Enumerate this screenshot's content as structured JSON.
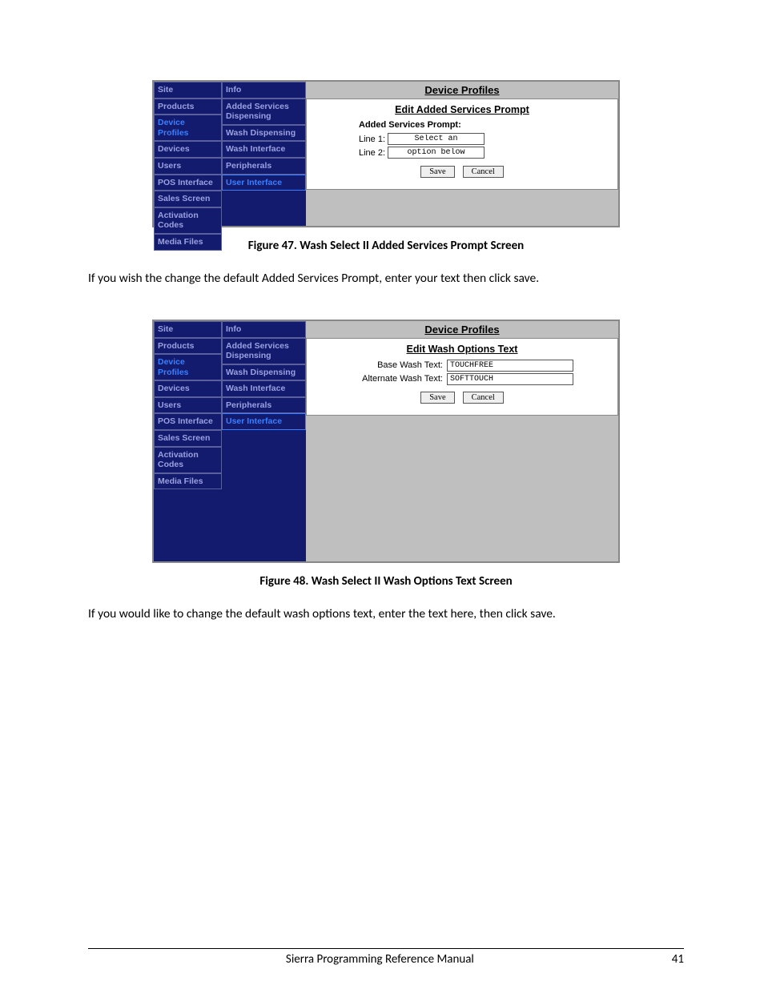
{
  "fig47": {
    "nav1": [
      "Site",
      "Products",
      "Device Profiles",
      "Devices",
      "Users",
      "POS Interface",
      "Sales Screen",
      "Activation Codes",
      "Media Files"
    ],
    "nav1_sel": "Device Profiles",
    "nav2": [
      "Info",
      "Added Services Dispensing",
      "Wash Dispensing",
      "Wash Interface",
      "Peripherals",
      "User Interface"
    ],
    "nav2_sel": "User Interface",
    "title": "Device Profiles",
    "subtitle": "Edit Added Services Prompt",
    "prompt_label": "Added Services Prompt:",
    "line1_lbl": "Line 1:",
    "line1_val": "Select an",
    "line2_lbl": "Line 2:",
    "line2_val": "option below",
    "save": "Save",
    "cancel": "Cancel",
    "caption": "Figure 47. Wash Select II Added Services Prompt Screen"
  },
  "para1": "If you wish the change the default Added Services Prompt, enter your text then click save.",
  "fig48": {
    "nav1": [
      "Site",
      "Products",
      "Device Profiles",
      "Devices",
      "Users",
      "POS Interface",
      "Sales Screen",
      "Activation Codes",
      "Media Files"
    ],
    "nav1_sel": "Device Profiles",
    "nav2": [
      "Info",
      "Added Services Dispensing",
      "Wash Dispensing",
      "Wash Interface",
      "Peripherals",
      "User Interface"
    ],
    "nav2_sel": "User Interface",
    "title": "Device Profiles",
    "subtitle": "Edit Wash Options Text",
    "base_lbl": "Base Wash Text:",
    "base_val": "TOUCHFREE",
    "alt_lbl": "Alternate Wash Text:",
    "alt_val": "SOFTTOUCH",
    "save": "Save",
    "cancel": "Cancel",
    "caption": "Figure 48. Wash Select II Wash Options Text Screen"
  },
  "para2": "If you would like to change the default wash options text, enter the text here, then click save.",
  "footer_title": "Sierra Programming Reference Manual",
  "footer_page": "41"
}
